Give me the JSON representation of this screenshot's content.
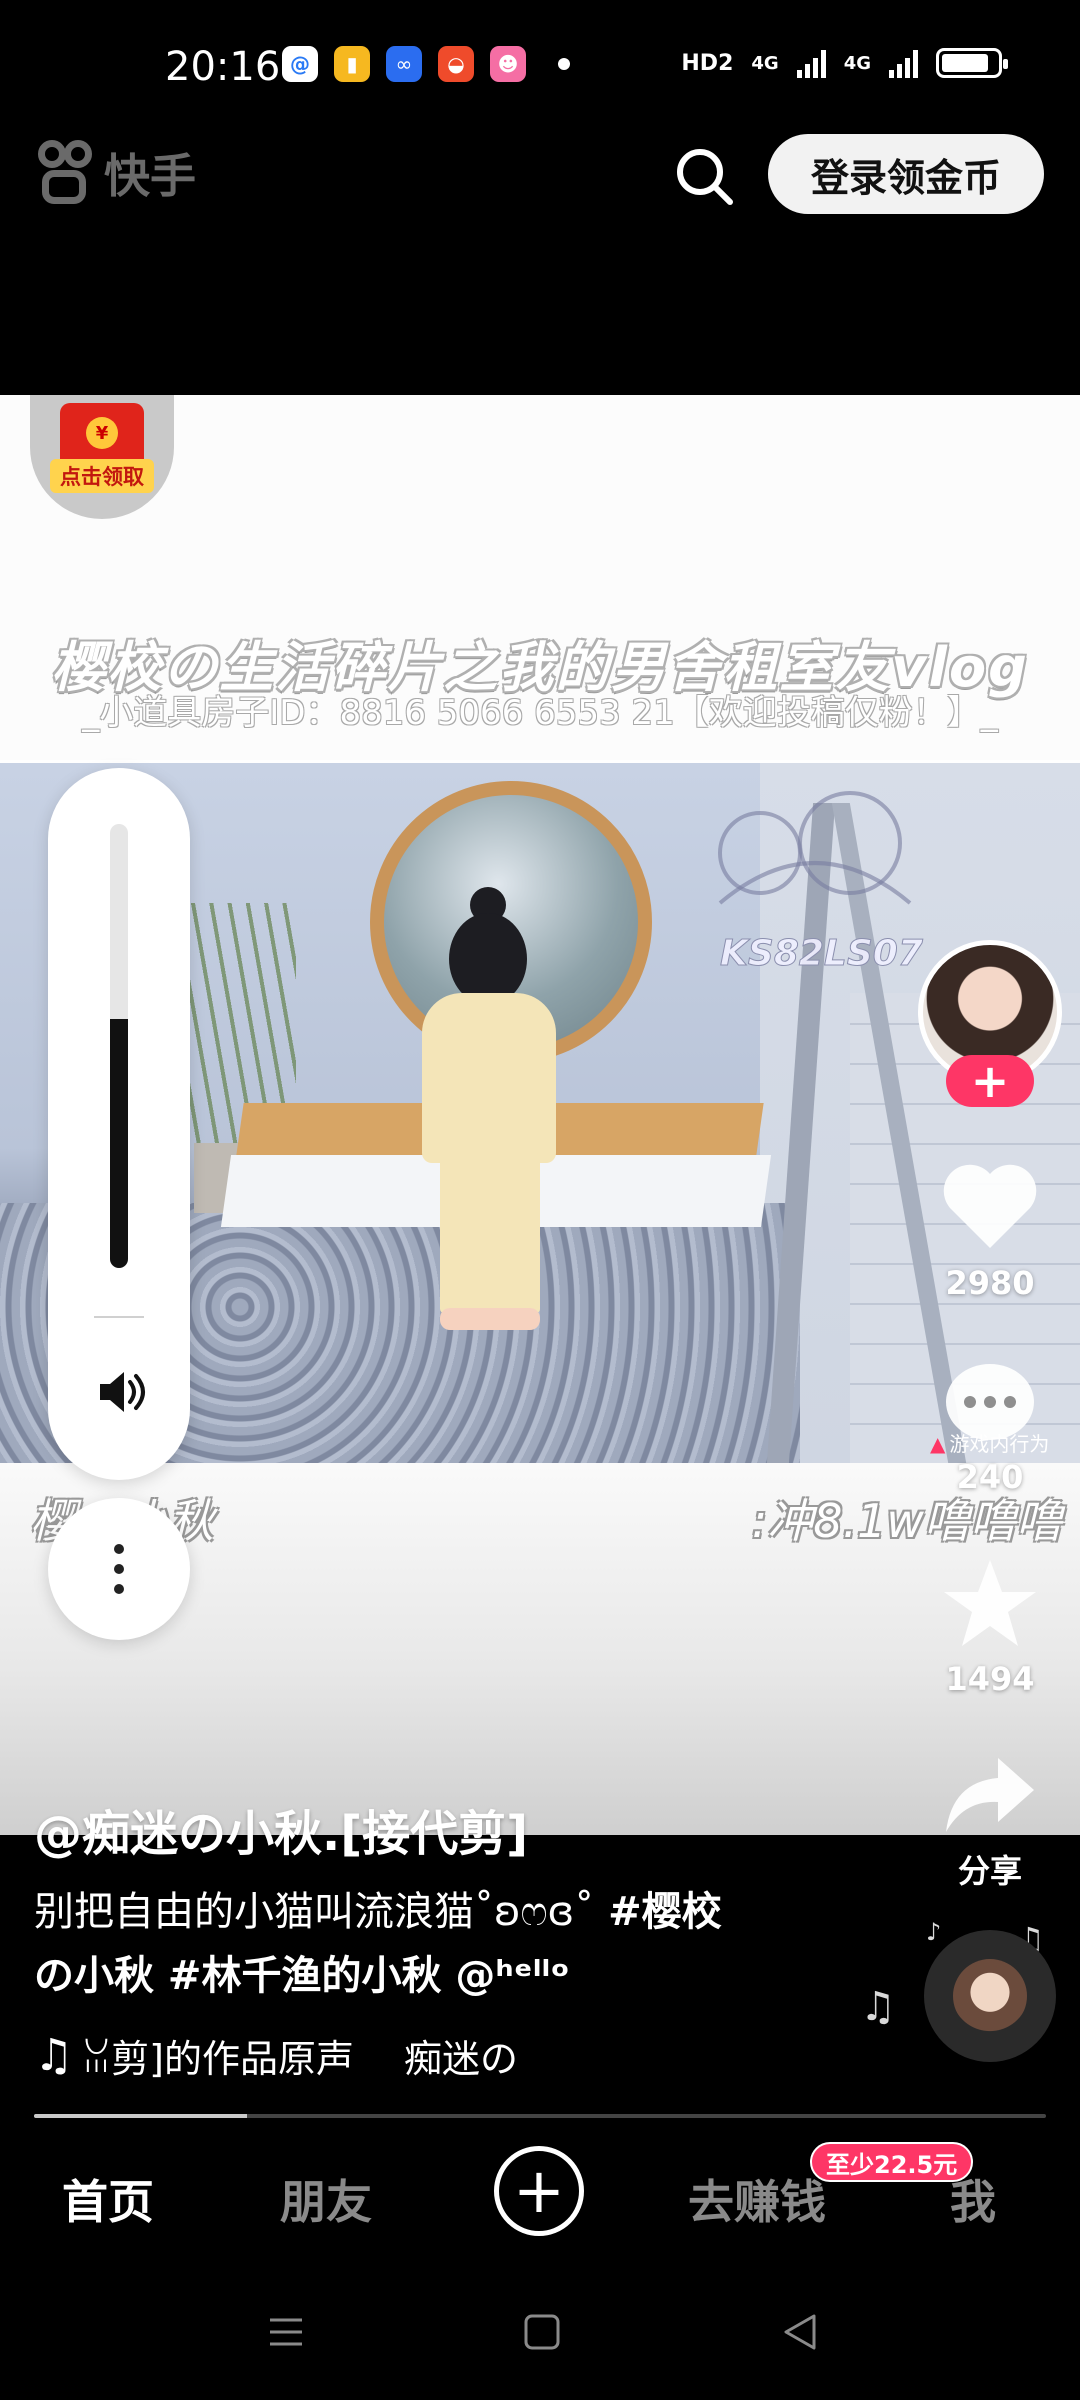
{
  "status_bar": {
    "time": "20:16",
    "network_labels": [
      "HD2",
      "4G",
      "4G"
    ],
    "battery_level": 0.85,
    "notification_icons": [
      "qq-browser-icon",
      "books-icon",
      "link-icon",
      "game-icon",
      "chat-icon"
    ]
  },
  "header": {
    "logo_text": "快手",
    "login_button": "登录领金币"
  },
  "video": {
    "red_packet_label": "点击领取",
    "red_packet_symbol": "¥",
    "title": "樱校の生活碎片之我的男舍租室友vlog",
    "subtitle": "_小道具房子ID：8816 5066 6553 21【欢迎投稿仅粉！】_",
    "watermark_id": "KS82LS07",
    "deco_left": "樱…小秋",
    "deco_right": ":冲8.1w噜噜噜"
  },
  "volume": {
    "level": 0.56
  },
  "actions": {
    "follow_symbol": "+",
    "like_count": "2980",
    "comment_count": "240",
    "report_label": "游戏内行为",
    "favorite_count": "1494",
    "share_label": "分享"
  },
  "post": {
    "author": "@痴迷の小秋.[接代剪]",
    "caption_line1": "别把自由的小猫叫流浪猫˚ʚෆɞ˚",
    "caption_tag1": " #樱校",
    "caption_line2": "の小秋 #林千渔的小秋 @ʰᵉˡˡᵒ",
    "music_text": "ꈍ剪]的作品原声 　痴迷の",
    "progress": 0.21
  },
  "tabs": {
    "home": "首页",
    "friends": "朋友",
    "earn": "去赚钱",
    "me": "我",
    "earn_badge": "至少22.5元"
  },
  "colors": {
    "accent_pink": "#fe3666",
    "background": "#000000"
  }
}
